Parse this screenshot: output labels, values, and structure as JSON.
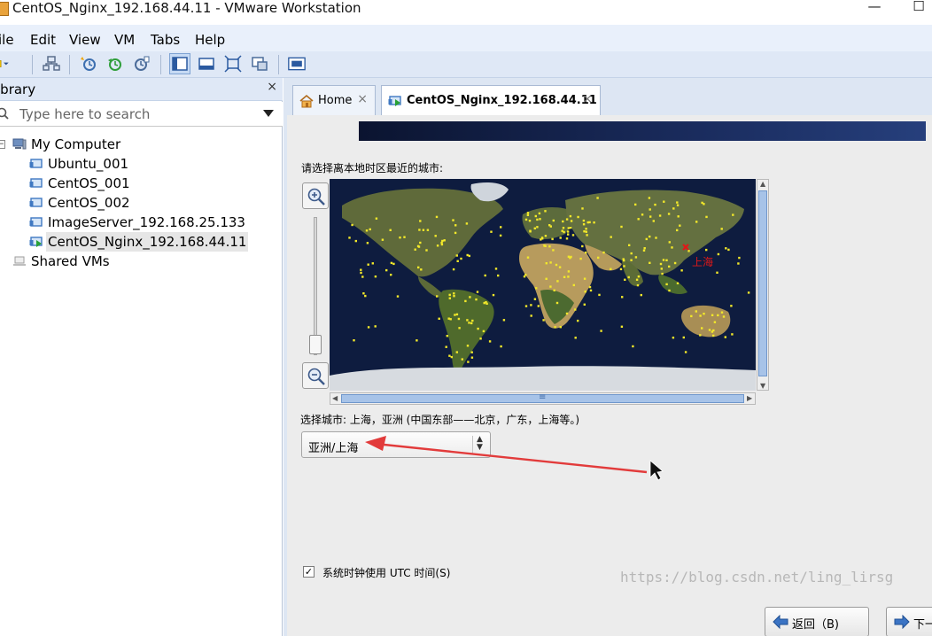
{
  "window": {
    "title": "CentOS_Nginx_192.168.44.11 - VMware Workstation",
    "maximize_glyph": "☐",
    "minimize_glyph": "—"
  },
  "menu": [
    "ile",
    "Edit",
    "View",
    "VM",
    "Tabs",
    "Help"
  ],
  "library": {
    "title": "ibrary",
    "close_glyph": "×",
    "search_placeholder": "Type here to search",
    "tree": [
      {
        "label": "My Computer",
        "level": 0,
        "expanded": true,
        "icon": "computer-icon"
      },
      {
        "label": "Ubuntu_001",
        "level": 1,
        "icon": "vm-icon"
      },
      {
        "label": "CentOS_001",
        "level": 1,
        "icon": "vm-icon"
      },
      {
        "label": "CentOS_002",
        "level": 1,
        "icon": "vm-icon"
      },
      {
        "label": "ImageServer_192.168.25.133",
        "level": 1,
        "icon": "vm-icon"
      },
      {
        "label": "CentOS_Nginx_192.168.44.11",
        "level": 1,
        "icon": "vm-running-icon",
        "selected": true
      },
      {
        "label": "Shared VMs",
        "level": 0,
        "icon": "shared-vms-icon"
      }
    ]
  },
  "tabs": [
    {
      "label": "Home",
      "icon": "home-icon",
      "close": "×"
    },
    {
      "label": "CentOS_Nginx_192.168.44.11",
      "icon": "vm-running-icon",
      "close": "×",
      "active": true
    }
  ],
  "installer": {
    "prompt": "请选择离本地时区最近的城市:",
    "marker_city": "上海",
    "selected_city_text": "选择城市: 上海，亚洲 (中国东部——北京，广东，上海等。)",
    "timezone_value": "亚洲/上海",
    "utc_checkbox": {
      "label": "系统时钟使用 UTC 时间(S)",
      "checked": true
    },
    "back_button": "返回（B)",
    "next_button": "下一",
    "scroll_grip": "≡"
  },
  "watermark": "https://blog.csdn.net/ling_lirsg",
  "colors": {
    "menubar_bg": "#e9f0fb",
    "toolbar_bg": "#dfe8f6",
    "annotation_arrow": "#e23b3b",
    "map_ocean": "#0e1c3f",
    "city_dot": "#f2e82a"
  }
}
